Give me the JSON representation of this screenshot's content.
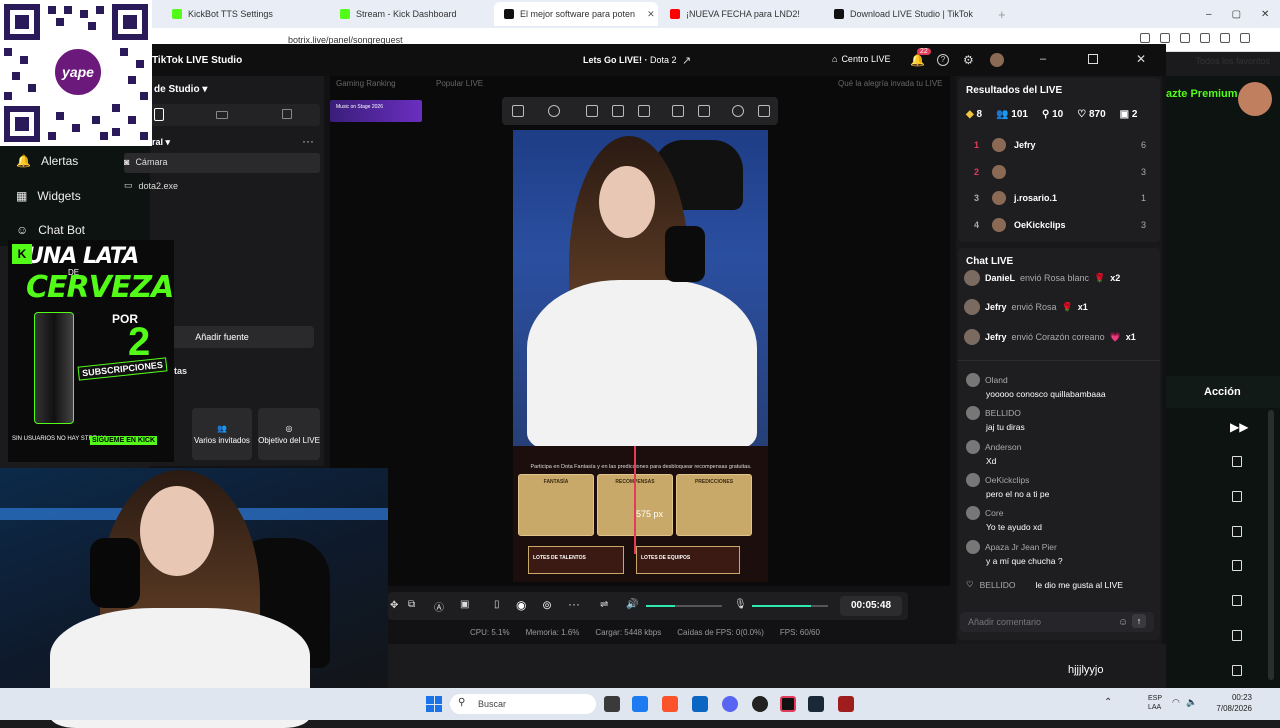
{
  "browser": {
    "tabs": [
      {
        "label": "KickBot TTS Settings",
        "color": "#53fc18"
      },
      {
        "label": "Stream - Kick Dashboard",
        "color": "#53fc18"
      },
      {
        "label": "El mejor software para poten",
        "color": "#111111",
        "active": true
      },
      {
        "label": "¡NUEVA FECHA para LND2!",
        "color": "#ff0000"
      },
      {
        "label": "Download LIVE Studio | TikTok",
        "color": "#111111"
      }
    ],
    "url": "botrix.live/panel/songrequest",
    "favorites": "Todos los favoritos"
  },
  "sidebar": {
    "items": [
      {
        "label": "Alertas"
      },
      {
        "label": "Widgets"
      },
      {
        "label": "Chat Bot"
      }
    ]
  },
  "studio": {
    "app_title": "TikTok LIVE Studio",
    "scene_title": "Lets Go LIVE!",
    "game": "Dota 2",
    "centro_live": "Centro LIVE",
    "notif_count": "22",
    "studio_menu": "de Studio",
    "scene_group": "ral",
    "sources": [
      {
        "label": "Cámara"
      },
      {
        "label": "dota2.exe"
      }
    ],
    "add_source": "Añadir fuente",
    "tools_label": "tas",
    "tools": [
      {
        "label": "Varios invitados"
      },
      {
        "label": "Objetivo del LIVE"
      }
    ],
    "banner_left": "Gaming Ranking",
    "banner_mid": "Popular LIVE",
    "banner_right": "Qué la alegría invada tu LIVE",
    "thumb_text": "Music on Stage 2026",
    "overlay_text": "Participa en Dota Fantasía y en las predicciones para desbloquear recompensas gratuitas.",
    "cards": [
      {
        "label": "FANTASÍA"
      },
      {
        "label": "RECOMPENSAS"
      },
      {
        "label": "PREDICCIONES"
      }
    ],
    "overlay_bottom_left": "LOTES DE TALENTOS",
    "overlay_bottom_right": "LOTES DE EQUIPOS",
    "px_label": "575 px",
    "timer": "00:05:48",
    "stats": {
      "cpu": "CPU: 5.1%",
      "memoria": "Memoria: 1.6%",
      "cargar": "Cargar: 5448 kbps",
      "caidas": "Caídas de FPS: 0(0.0%)",
      "fps": "FPS: 60/60"
    }
  },
  "live_results": {
    "title": "Resultados del LIVE",
    "stats": [
      "8",
      "101",
      "10",
      "870",
      "2"
    ],
    "ranking": [
      {
        "rank": "1",
        "name": "Jefry",
        "score": "6"
      },
      {
        "rank": "2",
        "name": "",
        "score": "3"
      },
      {
        "rank": "3",
        "name": "j.rosario.1",
        "score": "1"
      },
      {
        "rank": "4",
        "name": "OeKickclips",
        "score": "3"
      }
    ]
  },
  "chat_live": {
    "title": "Chat LIVE",
    "gifts": [
      {
        "name": "DanieL",
        "text": "envió Rosa blanc",
        "count": "x2"
      },
      {
        "name": "Jefry",
        "text": "envió Rosa",
        "count": "x1"
      },
      {
        "name": "Jefry",
        "text": "envió Corazón coreano",
        "count": "x1"
      }
    ],
    "messages": [
      {
        "name": "Oland",
        "text": "yooooo conosco quillabambaaa"
      },
      {
        "name": "BELLIDO",
        "text": "jaj tu diras"
      },
      {
        "name": "Anderson",
        "text": "Xd"
      },
      {
        "name": "OeKickclips",
        "text": "pero el no a ti pe"
      },
      {
        "name": "Core",
        "text": "Yo te ayudo xd"
      },
      {
        "name": "Apaza Jr Jean Pier",
        "text": "y a mí que chucha ?"
      }
    ],
    "like_msg": {
      "name": "BELLIDO",
      "text": "le dio me gusta al LIVE"
    },
    "comment_placeholder": "Añadir comentario"
  },
  "kick": {
    "premium": "azte Premium",
    "action_header": "Acción",
    "bottom_text": "hjjjlyyjo"
  },
  "qr": {
    "brand": "yape"
  },
  "beer_ad": {
    "line1": "UNA LATA",
    "line2": "DE",
    "line3": "CERVEZA",
    "line4": "POR",
    "line5": "2",
    "line6": "SUBSCRIPCIONES",
    "line7": "SIN USUARIOS NO HAY STREAM",
    "line8": "SÍGUEME EN KICK"
  },
  "taskbar": {
    "search": "Buscar",
    "lang": "ESP",
    "lang2": "LAA",
    "time": "00:23",
    "date": "7/08/2026"
  }
}
